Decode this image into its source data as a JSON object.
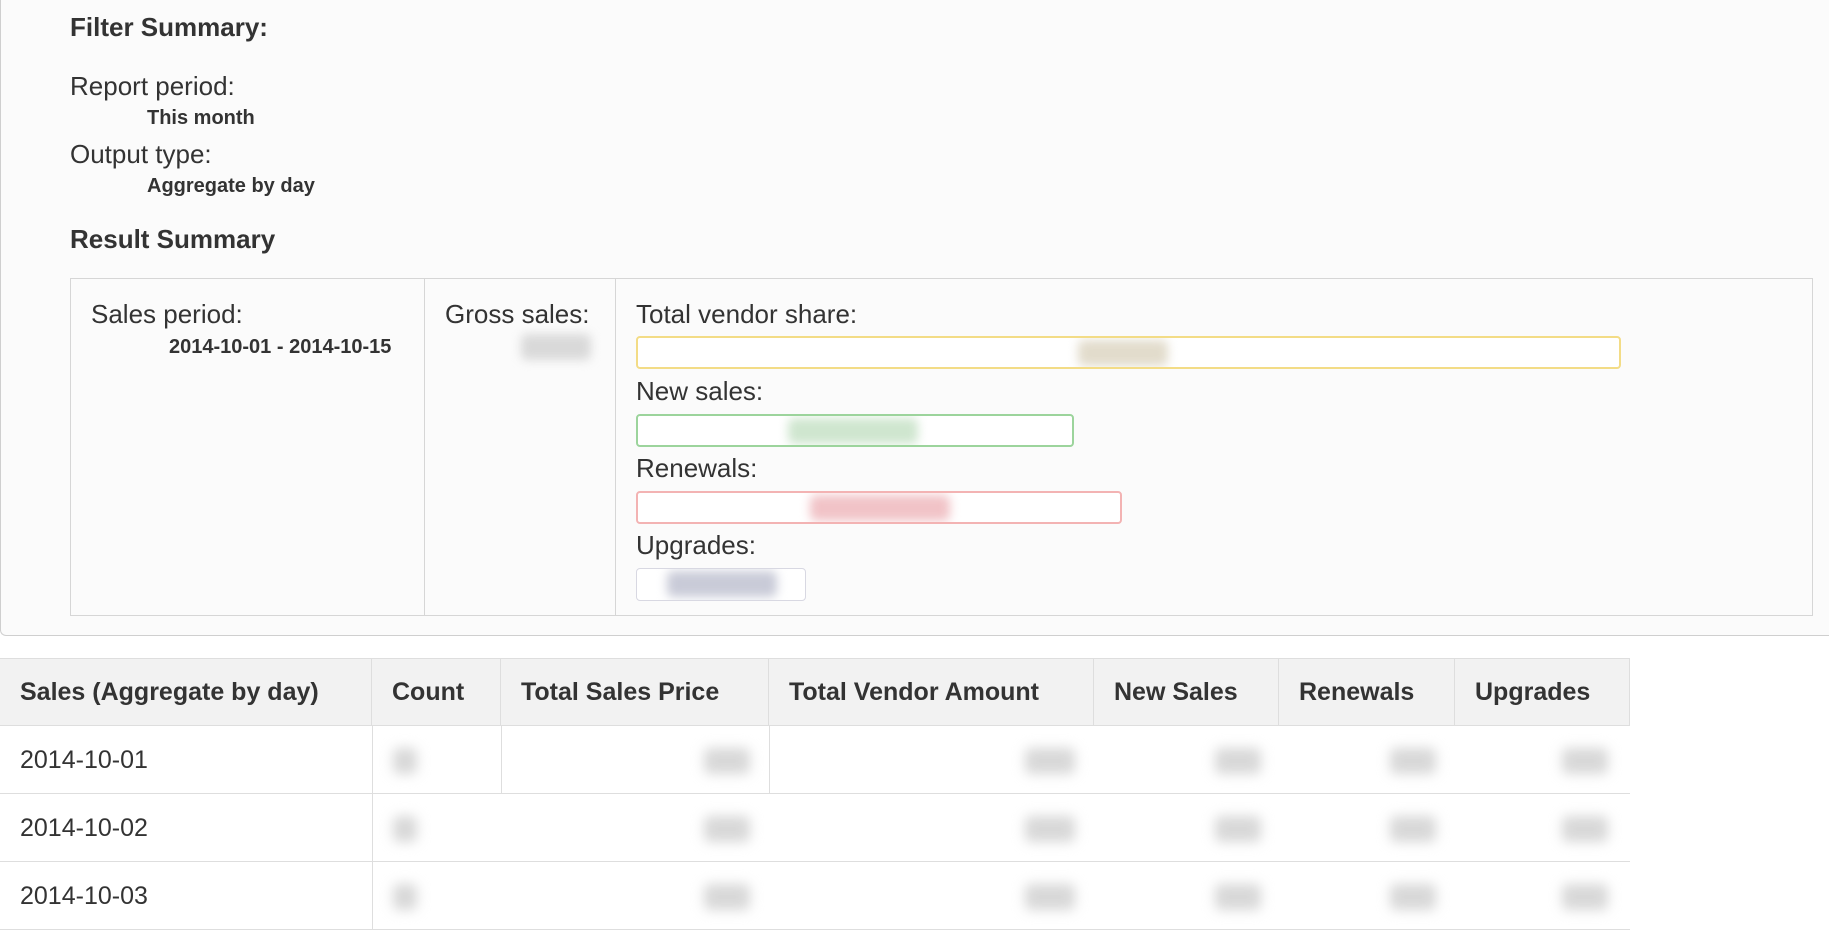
{
  "filter_summary": {
    "heading": "Filter Summary:",
    "report_period_label": "Report period:",
    "report_period_value": "This month",
    "output_type_label": "Output type:",
    "output_type_value": "Aggregate by day"
  },
  "result_summary": {
    "heading": "Result Summary",
    "sales_period_label": "Sales period:",
    "sales_period_value": "2014-10-01 - 2014-10-15",
    "gross_sales_label": "Gross sales:",
    "total_vendor_share_label": "Total vendor share:",
    "new_sales_label": "New sales:",
    "renewals_label": "Renewals:",
    "upgrades_label": "Upgrades:"
  },
  "colors": {
    "vendor_bar": "#f3dc86",
    "new_sales_bar": "#9cd49c",
    "renewals_bar": "#f3b3b3",
    "upgrades_bar": "#d8d8e2"
  },
  "table": {
    "headers": [
      "Sales (Aggregate by day)",
      "Count",
      "Total Sales Price",
      "Total Vendor Amount",
      "New Sales",
      "Renewals",
      "Upgrades"
    ],
    "rows": [
      {
        "date": "2014-10-01"
      },
      {
        "date": "2014-10-02"
      },
      {
        "date": "2014-10-03"
      }
    ]
  }
}
